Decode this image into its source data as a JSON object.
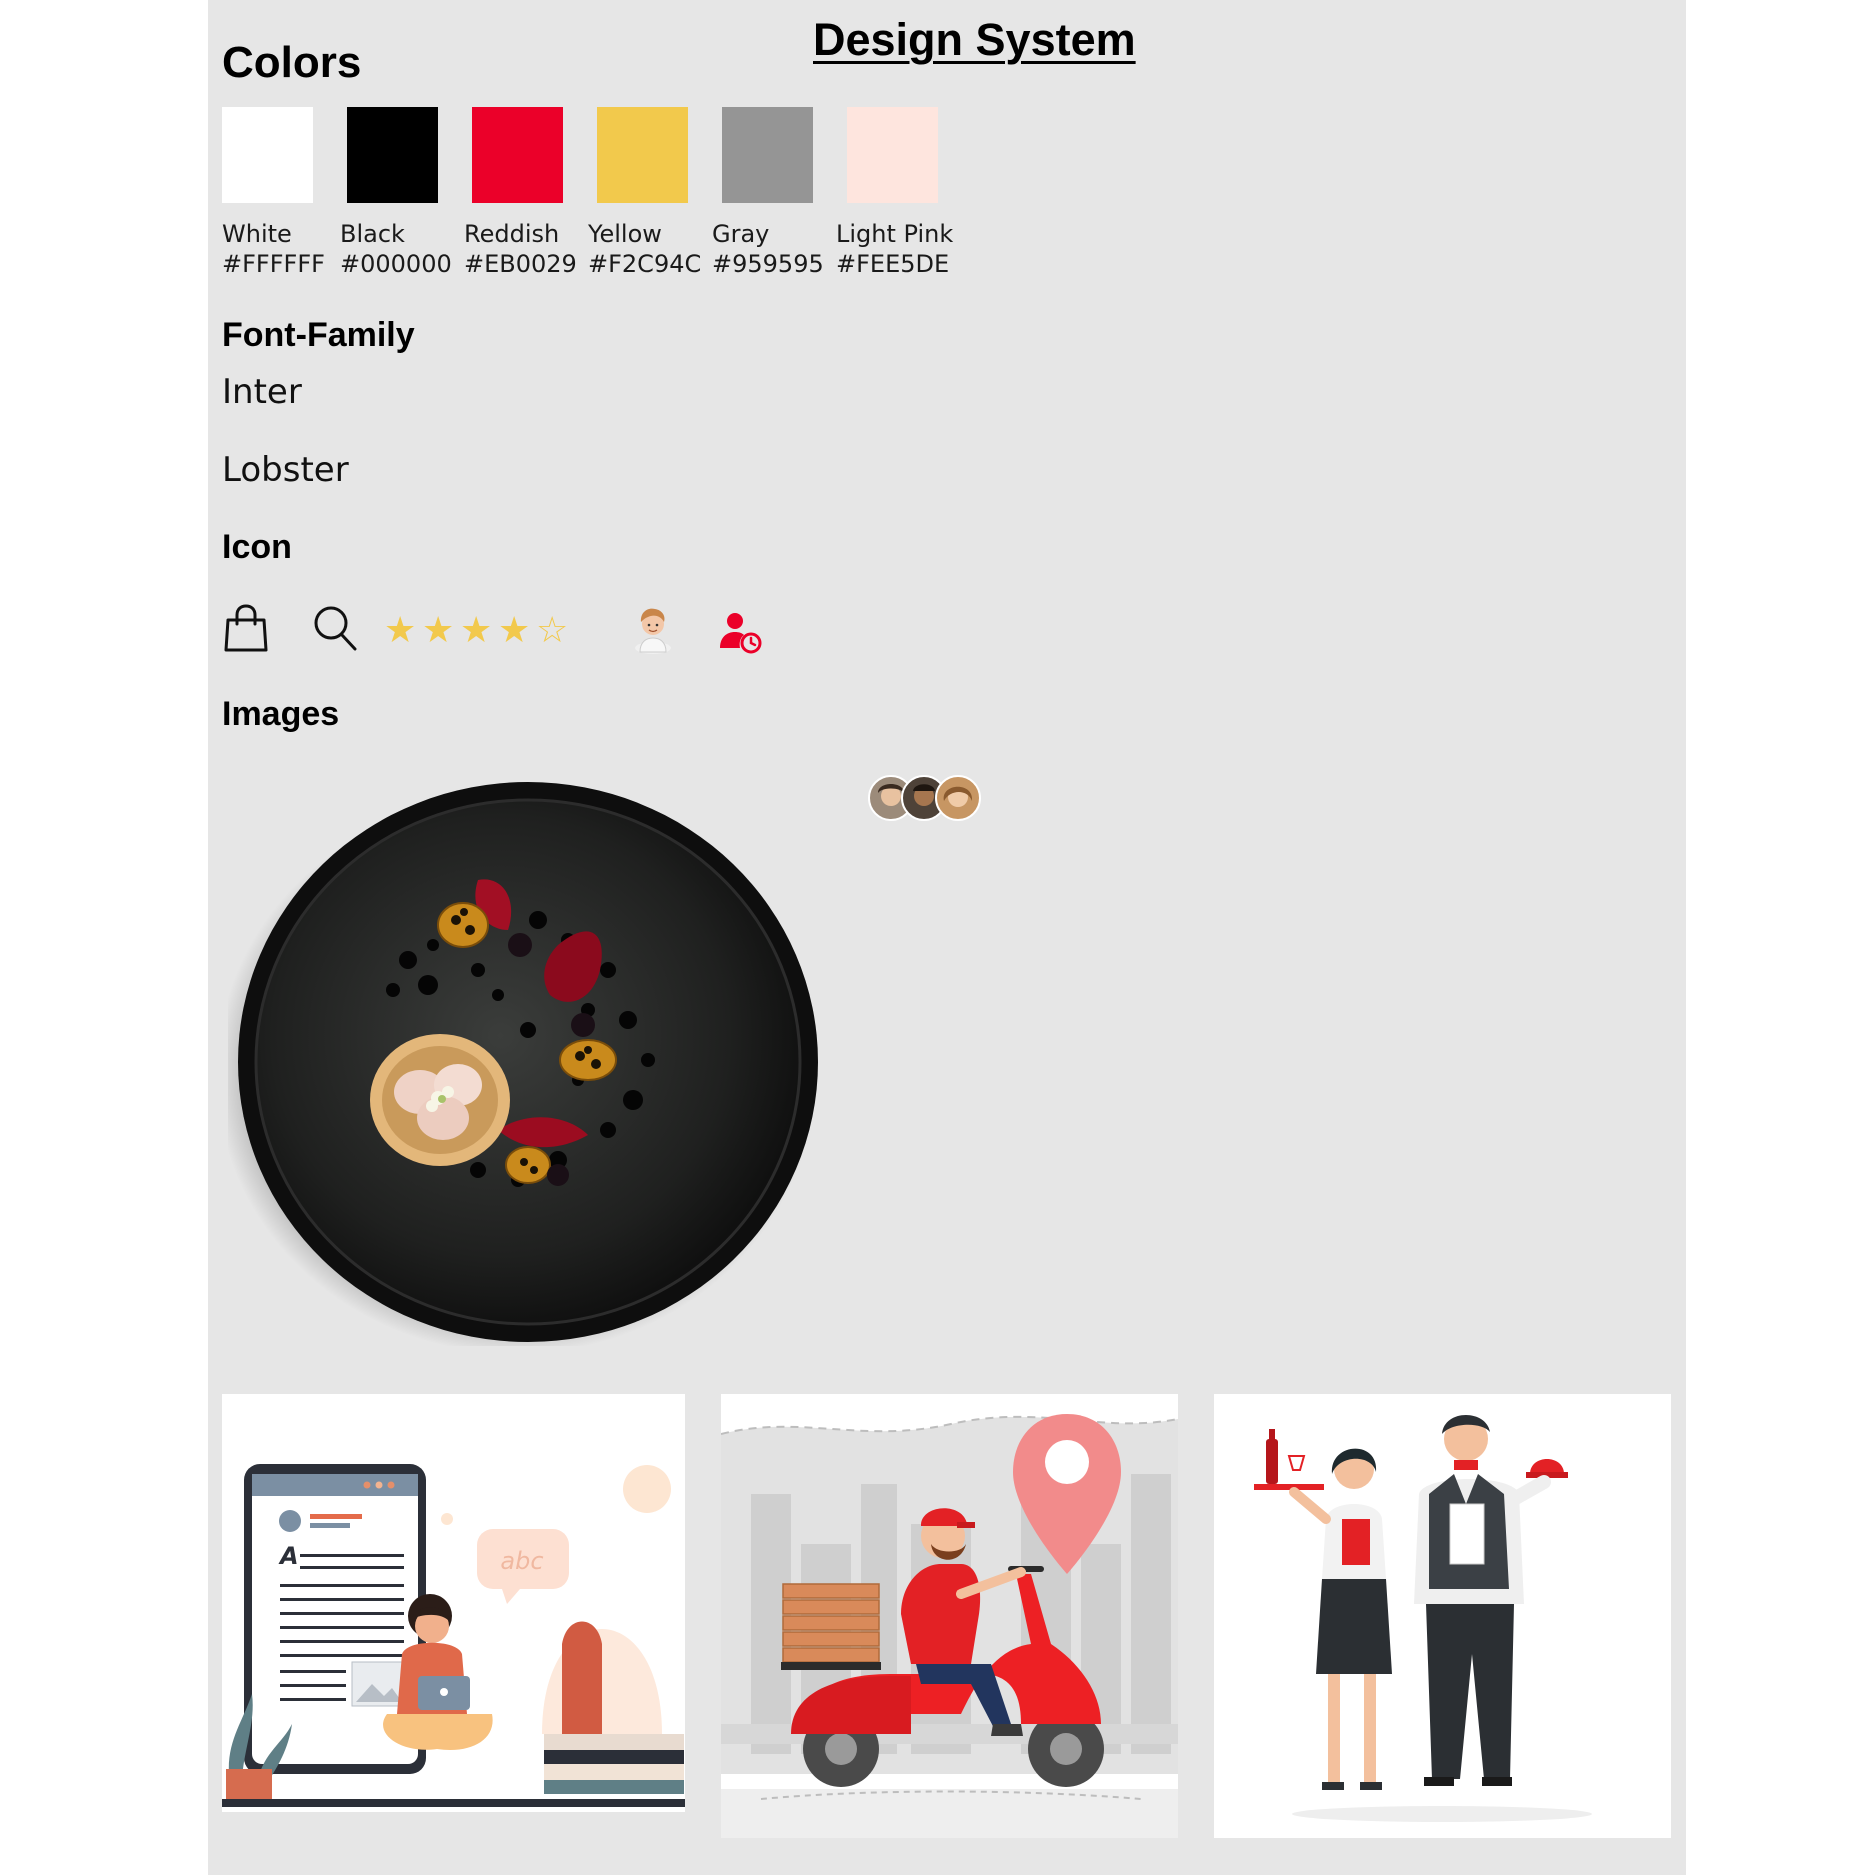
{
  "title": "Design System",
  "sections": {
    "colors": "Colors",
    "font_family": "Font-Family",
    "icon": "Icon",
    "images": "Images"
  },
  "colors": [
    {
      "name": "White",
      "hex": "#FFFFFF"
    },
    {
      "name": "Black",
      "hex": "#000000"
    },
    {
      "name": "Reddish",
      "hex": "#EB0029"
    },
    {
      "name": "Yellow",
      "hex": "#F2C94C"
    },
    {
      "name": "Gray",
      "hex": "#959595"
    },
    {
      "name": "Light Pink",
      "hex": "#FEE5DE"
    }
  ],
  "fonts": [
    "Inter",
    "Lobster"
  ],
  "icons": [
    "shopping-bag-icon",
    "search-icon",
    "star-rating-icon",
    "avatar-icon",
    "user-clock-icon"
  ],
  "rating": {
    "value": 4,
    "max": 5
  },
  "image_cards": {
    "reading_text": "abc"
  }
}
